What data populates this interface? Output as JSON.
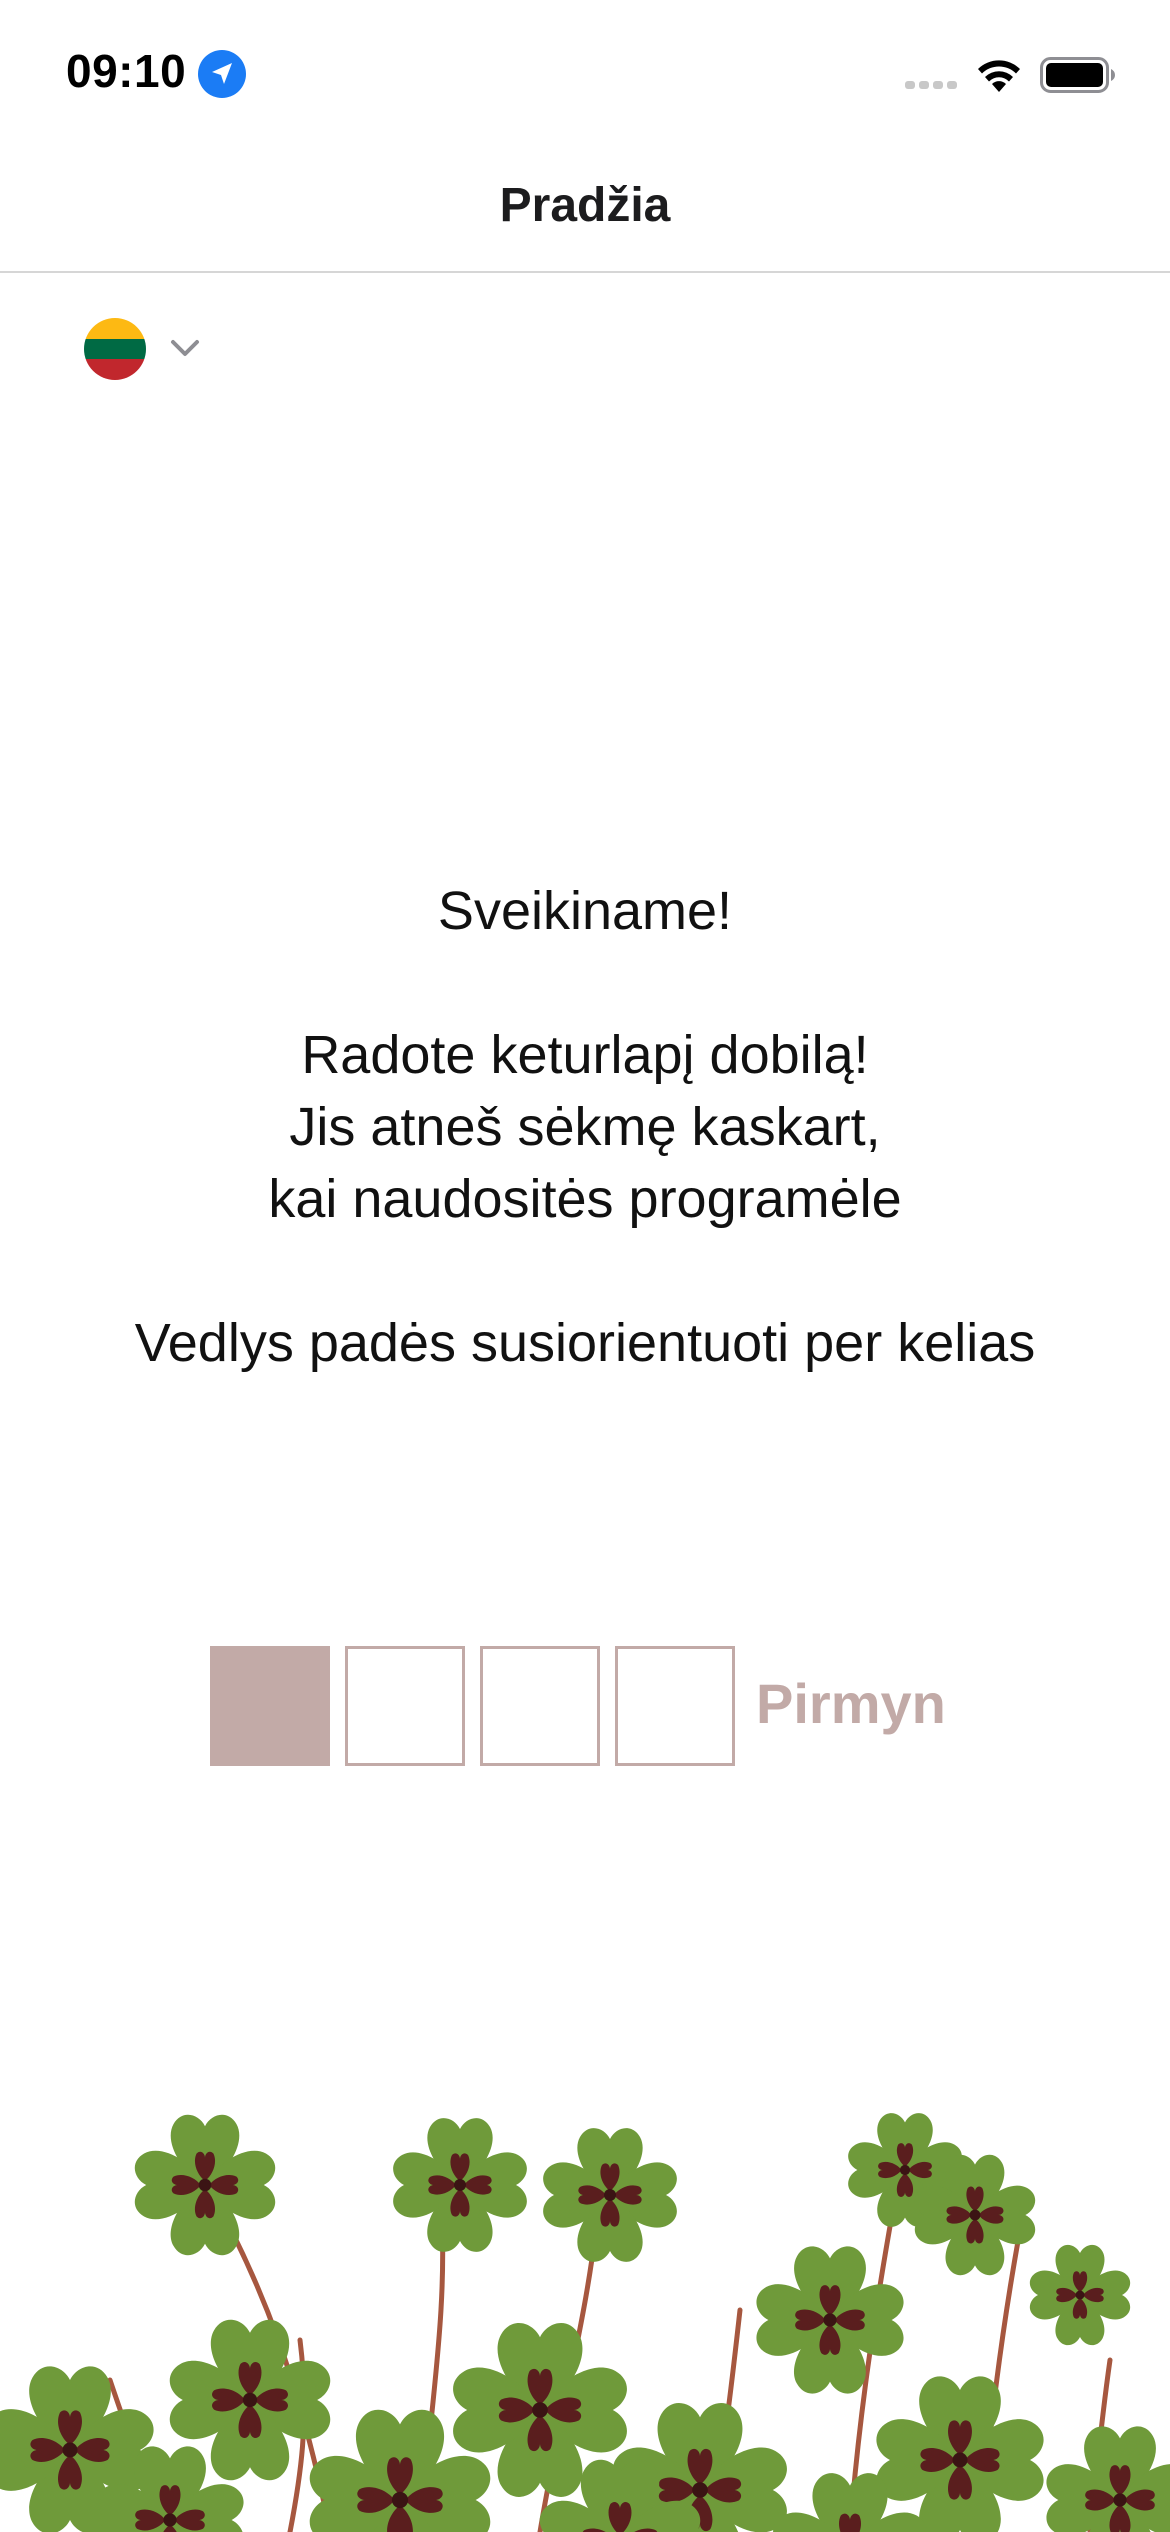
{
  "status_bar": {
    "time": "09:10",
    "icons": [
      "location-arrow-icon",
      "cellular-signal-icon",
      "wifi-icon",
      "battery-icon"
    ]
  },
  "nav": {
    "title": "Pradžia"
  },
  "language": {
    "flag": "lithuania-flag-icon",
    "flag_colors": [
      "#FDB913",
      "#006A44",
      "#C1272D"
    ]
  },
  "welcome": {
    "line_1": "Sveikiname!",
    "line_2": "Radote keturlapį dobilą!",
    "line_3": "Jis atneš sėkmę kaskart,",
    "line_4": "kai naudositės programėle",
    "line_5": "Vedlys padės susiorientuoti per kelias"
  },
  "wizard": {
    "total_steps": 4,
    "current_step": 1,
    "next_label": "Pirmyn"
  },
  "colors": {
    "accent": "#C2AAA7",
    "location_blue": "#1B7CF5",
    "divider": "#D6D6D6"
  },
  "decoration": {
    "image": "four-leaf-clover-plants"
  }
}
